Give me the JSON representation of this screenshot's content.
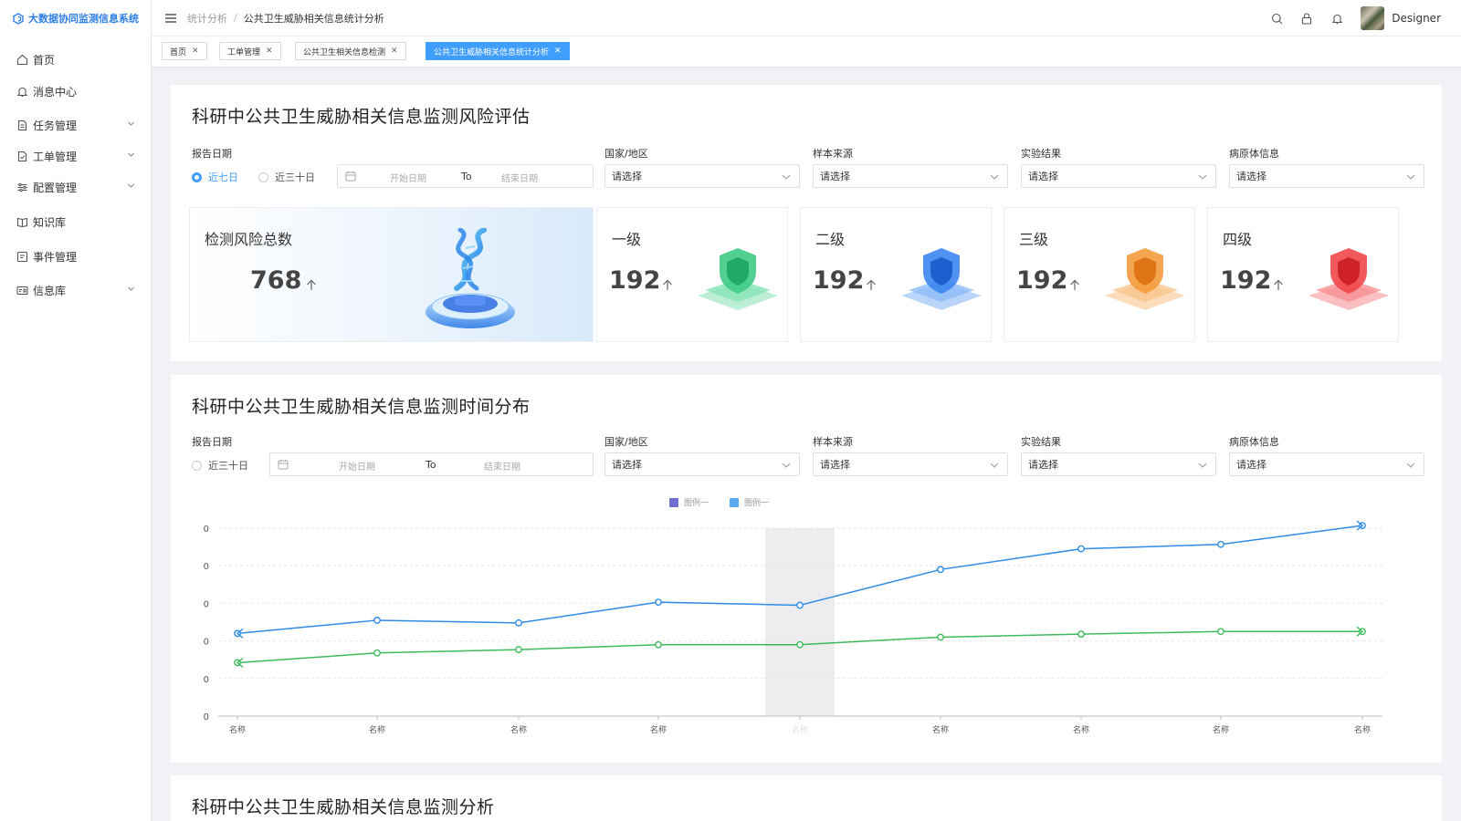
{
  "app": {
    "brand": "大数据协同监测信息系统"
  },
  "sidebar": {
    "items": [
      {
        "label": "首页",
        "icon": "home-icon"
      },
      {
        "label": "消息中心",
        "icon": "bell-icon"
      },
      {
        "label": "任务管理",
        "icon": "document-icon",
        "expandable": true
      },
      {
        "label": "工单管理",
        "icon": "file-check-icon",
        "expandable": true
      },
      {
        "label": "配置管理",
        "icon": "sliders-icon",
        "expandable": true
      },
      {
        "label": "知识库",
        "icon": "book-icon"
      },
      {
        "label": "事件管理",
        "icon": "event-icon"
      },
      {
        "label": "信息库",
        "icon": "info-card-icon",
        "expandable": true
      }
    ]
  },
  "header": {
    "breadcrumb": [
      "统计分析",
      "公共卫生威胁相关信息统计分析"
    ],
    "username": "Designer"
  },
  "tabs": [
    {
      "label": "首页"
    },
    {
      "label": "工单管理"
    },
    {
      "label": "公共卫生相关信息检测"
    },
    {
      "label": "公共卫生威胁相关信息统计分析",
      "active": true
    }
  ],
  "filters": {
    "report_date_label": "报告日期",
    "radio_7": "近七日",
    "radio_30": "近三十日",
    "start_placeholder": "开始日期",
    "to": "To",
    "end_placeholder": "结束日期",
    "country_label": "国家/地区",
    "source_label": "样本来源",
    "result_label": "实验结果",
    "pathogen_label": "病原体信息",
    "select_placeholder": "请选择"
  },
  "section1": {
    "title": "科研中公共卫生威胁相关信息监测风险评估",
    "total_card": {
      "title": "检测风险总数",
      "value": "768"
    },
    "level_cards": [
      {
        "title": "一级",
        "value": "192",
        "color": "#3ecb86"
      },
      {
        "title": "二级",
        "value": "192",
        "color": "#3c86f0"
      },
      {
        "title": "三级",
        "value": "192",
        "color": "#f49b3c"
      },
      {
        "title": "四级",
        "value": "192",
        "color": "#f0474b"
      }
    ]
  },
  "section2": {
    "title": "科研中公共卫生威胁相关信息监测时间分布"
  },
  "section3": {
    "title": "科研中公共卫生威胁相关信息监测分析"
  },
  "chart_data": {
    "type": "line",
    "categories": [
      "名称",
      "名称",
      "名称",
      "名称",
      "名称",
      "名称",
      "名称",
      "名称",
      "名称"
    ],
    "y_tick_labels": [
      "0",
      "0",
      "0",
      "0",
      "0",
      "0"
    ],
    "ylim": [
      0,
      5
    ],
    "highlighted_category_index": 4,
    "legend": [
      {
        "label": "图例一",
        "color": "#6f6fcf"
      },
      {
        "label": "图例一",
        "color": "#5aaaf0"
      }
    ],
    "series": [
      {
        "color": "#2f8be6",
        "values": [
          2.2,
          2.55,
          2.48,
          3.03,
          2.95,
          3.9,
          4.45,
          4.57,
          5.07
        ]
      },
      {
        "color": "#3dbb5c",
        "values": [
          1.42,
          1.68,
          1.77,
          1.9,
          1.9,
          2.1,
          2.18,
          2.25,
          2.25
        ]
      }
    ],
    "grid": true,
    "legend_position": "top-center"
  }
}
